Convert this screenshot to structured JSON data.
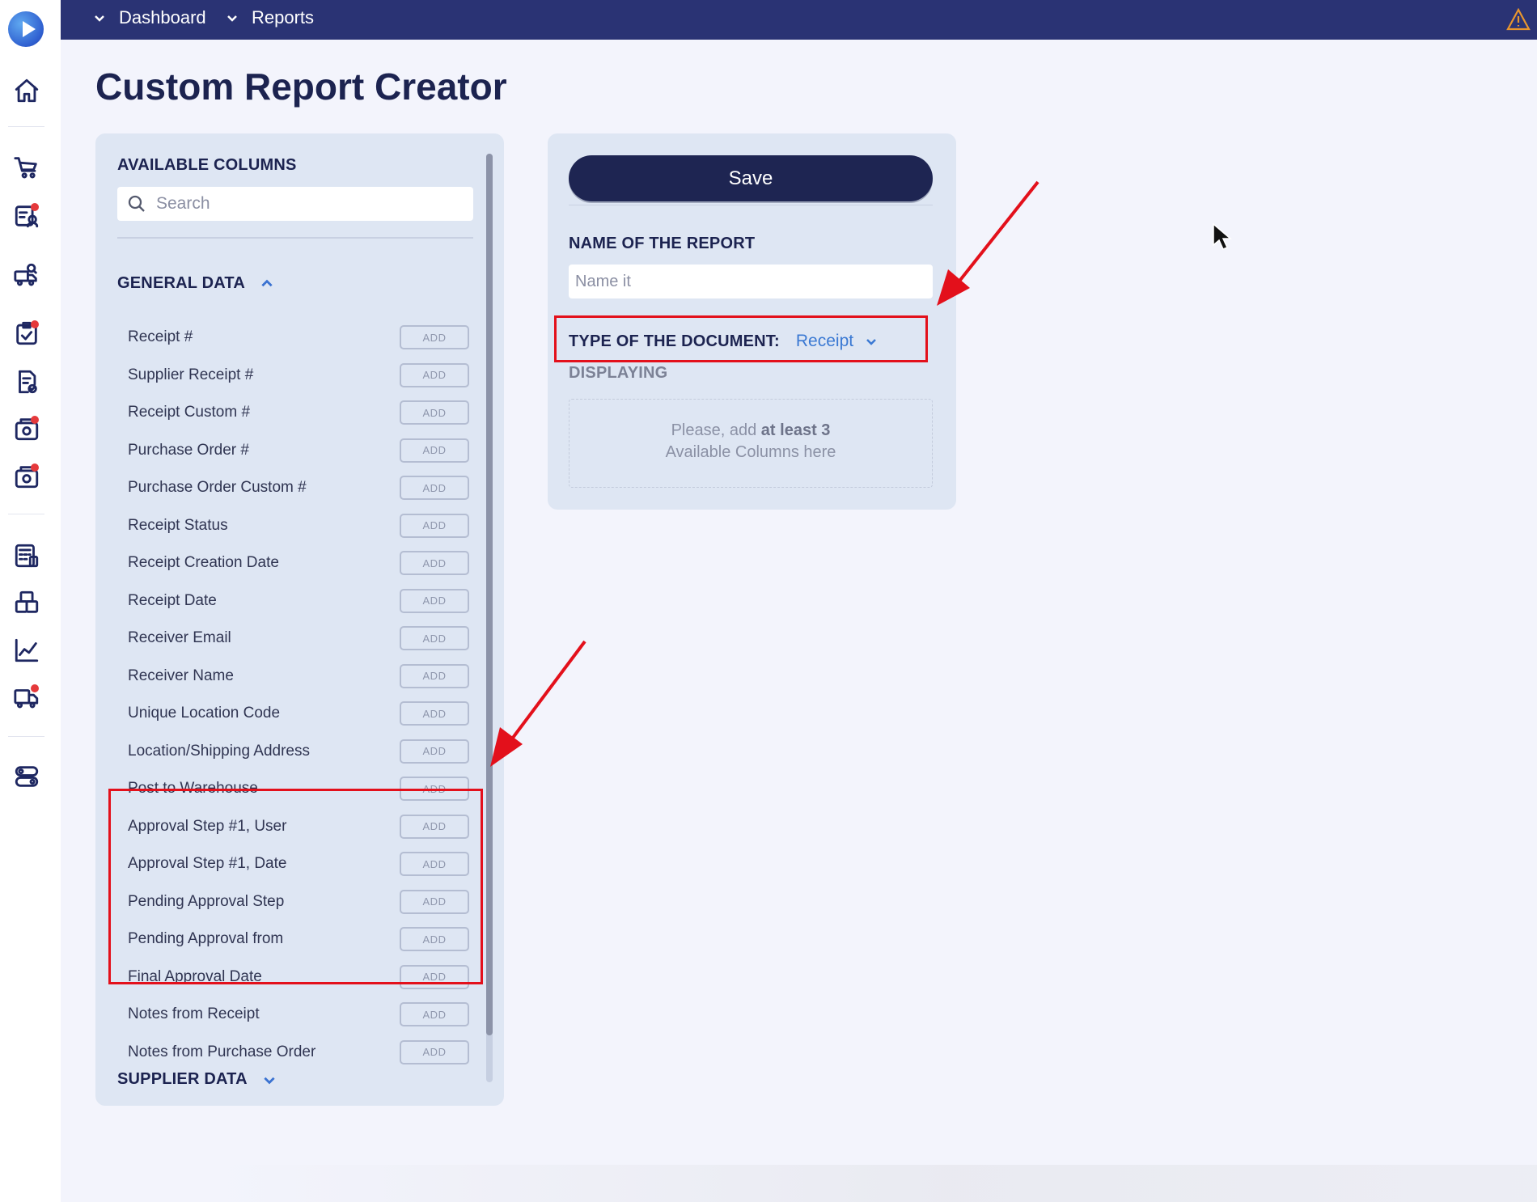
{
  "topbar": {
    "breadcrumbs": [
      "Dashboard",
      "Reports"
    ]
  },
  "page": {
    "title": "Custom Report Creator"
  },
  "available_columns": {
    "heading": "AVAILABLE COLUMNS",
    "search_placeholder": "Search",
    "general_group": "GENERAL DATA",
    "supplier_group": "SUPPLIER DATA",
    "add_label": "ADD",
    "items": [
      "Receipt #",
      "Supplier Receipt #",
      "Receipt Custom #",
      "Purchase Order #",
      "Purchase Order Custom #",
      "Receipt Status",
      "Receipt Creation Date",
      "Receipt Date",
      "Receiver Email",
      "Receiver Name",
      "Unique Location Code",
      "Location/Shipping Address",
      "Post to Warehouse",
      "Approval Step #1, User",
      "Approval Step #1, Date",
      "Pending Approval Step",
      "Pending Approval from",
      "Final Approval Date",
      "Notes from Receipt",
      "Notes from Purchase Order"
    ]
  },
  "report": {
    "save_label": "Save",
    "name_label": "NAME OF THE REPORT",
    "name_placeholder": "Name it",
    "type_label": "TYPE OF THE DOCUMENT:",
    "type_value": "Receipt",
    "displaying_label": "DISPLAYING",
    "drop_hint_1": "Please, add",
    "drop_hint_bold": "at least 3",
    "drop_hint_2": "Available Columns here"
  },
  "colors": {
    "topbar": "#2a3374",
    "accent": "#3b79d3",
    "annotation": "#e3101b",
    "panel": "#dee6f3"
  }
}
